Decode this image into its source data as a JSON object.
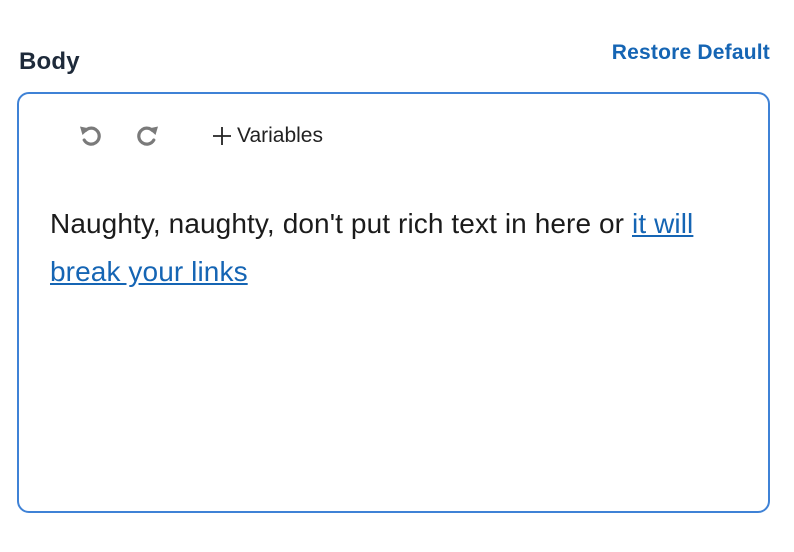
{
  "field": {
    "label": "Body",
    "restore_label": "Restore Default"
  },
  "toolbar": {
    "undo_icon": "undo-icon",
    "redo_icon": "redo-icon",
    "variables_label": "Variables"
  },
  "editor": {
    "text_before_link": "Naughty, naughty, don't put rich text in here or ",
    "link_text": "it will break your links"
  },
  "colors": {
    "accent": "#1565b4",
    "border": "#3f82d6",
    "icon_gray": "#7a7a7a"
  }
}
